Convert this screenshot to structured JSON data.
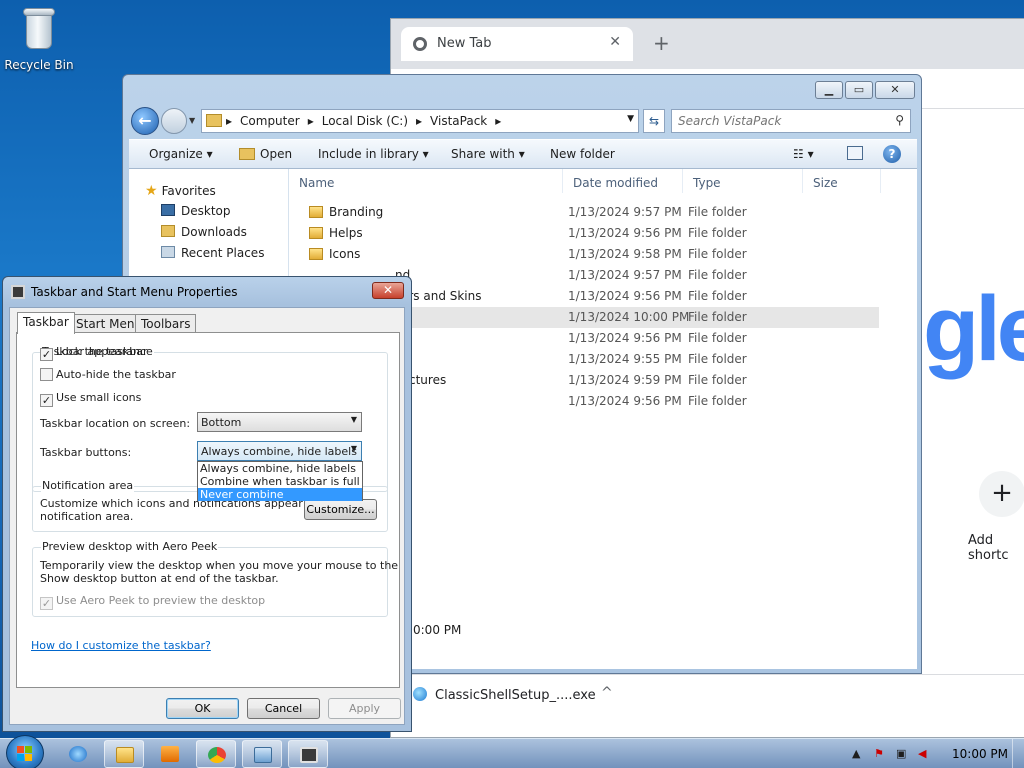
{
  "desktop": {
    "recycle_bin_label": "Recycle Bin"
  },
  "chrome": {
    "tab_title": "New Tab",
    "tab_close": "✕",
    "new_tab": "+",
    "google_partial": "gle",
    "add_shortcut_icon": "+",
    "add_shortcut_label": "Add shortc",
    "download_filename": "ClassicShellSetup_....exe",
    "download_chevron": "^"
  },
  "explorer": {
    "breadcrumbs": [
      "Computer",
      "Local Disk (C:)",
      "VistaPack"
    ],
    "search_placeholder": "Search VistaPack",
    "toolbar": {
      "organize": "Organize ▾",
      "open": "Open",
      "include_in_library": "Include in library ▾",
      "share_with": "Share with ▾",
      "new_folder": "New folder"
    },
    "nav": {
      "favorites": "Favorites",
      "desktop": "Desktop",
      "downloads": "Downloads",
      "recent_places": "Recent Places"
    },
    "columns": {
      "name": "Name",
      "date_modified": "Date modified",
      "type": "Type",
      "size": "Size"
    },
    "rows": [
      {
        "name": "Branding",
        "date": "1/13/2024 9:57 PM",
        "type": "File folder"
      },
      {
        "name": "Helps",
        "date": "1/13/2024 9:56 PM",
        "type": "File folder"
      },
      {
        "name": "Icons",
        "date": "1/13/2024 9:58 PM",
        "type": "File folder"
      },
      {
        "name": "nd",
        "date": "1/13/2024 9:57 PM",
        "type": "File folder"
      },
      {
        "name": "ars and Skins",
        "date": "1/13/2024 9:56 PM",
        "type": "File folder"
      },
      {
        "name": "",
        "date": "1/13/2024 10:00 PM",
        "type": "File folder"
      },
      {
        "name": "",
        "date": "1/13/2024 9:56 PM",
        "type": "File folder"
      },
      {
        "name": "",
        "date": "1/13/2024 9:55 PM",
        "type": "File folder"
      },
      {
        "name": "ctures",
        "date": "1/13/2024 9:59 PM",
        "type": "File folder"
      },
      {
        "name": "",
        "date": "1/13/2024 9:56 PM",
        "type": "File folder"
      }
    ],
    "status_time": "0:00 PM"
  },
  "dialog": {
    "title": "Taskbar and Start Menu Properties",
    "close": "✕",
    "tabs": [
      "Taskbar",
      "Start Menu",
      "Toolbars"
    ],
    "appearance_group": "Taskbar appearance",
    "lock_taskbar": "Lock the taskbar",
    "lock_taskbar_checked": true,
    "auto_hide": "Auto-hide the taskbar",
    "auto_hide_checked": false,
    "small_icons": "Use small icons",
    "small_icons_checked": true,
    "location_label": "Taskbar location on screen:",
    "location_value": "Bottom",
    "buttons_label": "Taskbar buttons:",
    "buttons_value": "Always combine, hide labels",
    "buttons_options": [
      "Always combine, hide labels",
      "Combine when taskbar is full",
      "Never combine"
    ],
    "notification_group": "Notification area",
    "notification_text_1": "Customize which icons and notifications appear in the",
    "notification_text_2": "notification area.",
    "customize_button": "Customize...",
    "peek_group": "Preview desktop with Aero Peek",
    "peek_text_1": "Temporarily view the desktop when you move your mouse to the",
    "peek_text_2": "Show desktop button at end of the taskbar.",
    "peek_checkbox": "Use Aero Peek to preview the desktop",
    "peek_checked": true,
    "help_link": "How do I customize the taskbar?",
    "ok": "OK",
    "cancel": "Cancel",
    "apply": "Apply"
  },
  "taskbar": {
    "clock": "10:00 PM"
  },
  "colors": {
    "desktop_blue": "#1a78c8",
    "highlight": "#3399ff",
    "link": "#0066cc"
  }
}
